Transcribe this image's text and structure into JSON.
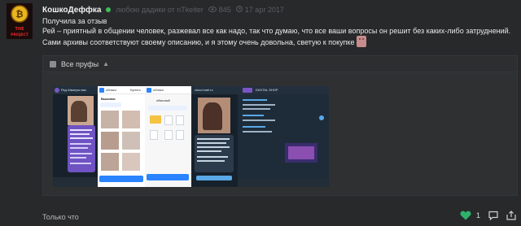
{
  "post": {
    "author": "КошкоДеффка",
    "meta_author_ref": "любою дадики от nTkeiter",
    "views": "845",
    "date": "17 apr 2017",
    "avatar_text_top": "THE",
    "avatar_text_bottom": "PROJECT"
  },
  "body": {
    "line1": "Получила за отзыв",
    "line2": "Рей – приятный в общении человек, разжевал все как надо, так что думаю, что все ваши вопросы он решит без каких-либо затруднений.",
    "line3": "Сами архивы соответствуют своему описанию, и я этому очень довольна, светую к покупке"
  },
  "proofs": {
    "title": "Все пруфы",
    "shot1_caption": "Ред Шматры вас",
    "shot2_header": "облако",
    "shot2_folder": "Выкинки",
    "shot2_button": "Купить",
    "shot3_header": "облако",
    "shot3_label": "обычный",
    "shot4_header": "cloud.mail.ru",
    "shot5_header": "DIGITAL SHOP"
  },
  "footer": {
    "label": "Только что",
    "likes": "1"
  },
  "colors": {
    "accent_green": "#3fbf5a",
    "background": "#27292b",
    "telegram_dark": "#17212b",
    "telegram_link": "#5aa9e6"
  }
}
